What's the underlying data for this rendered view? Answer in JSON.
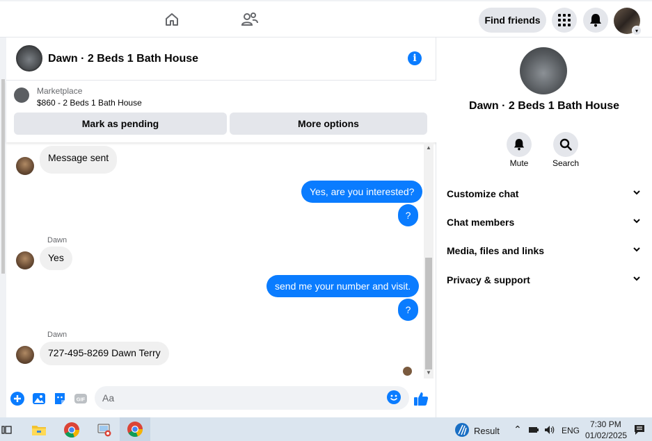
{
  "nav": {
    "find_friends": "Find friends"
  },
  "chat": {
    "title": "Dawn · 2 Beds 1 Bath House",
    "marketplace_label": "Marketplace",
    "listing": "$860 - 2 Beds 1 Bath House",
    "mark_pending": "Mark as pending",
    "more_options": "More options",
    "messages": [
      {
        "dir": "in",
        "text": "Message sent"
      },
      {
        "dir": "out",
        "text": "Yes, are you interested?"
      },
      {
        "dir": "out",
        "text": "?"
      },
      {
        "dir": "in",
        "sender": "Dawn",
        "text": "Yes"
      },
      {
        "dir": "out",
        "text": "send me your number and visit."
      },
      {
        "dir": "out",
        "text": "?"
      },
      {
        "dir": "in",
        "sender": "Dawn",
        "text": "727-495-8269 Dawn Terry"
      }
    ],
    "composer_placeholder": "Aa"
  },
  "details": {
    "title": "Dawn · 2 Beds 1 Bath House",
    "mute": "Mute",
    "search": "Search",
    "sections": [
      "Customize chat",
      "Chat members",
      "Media, files and links",
      "Privacy & support"
    ]
  },
  "taskbar": {
    "weather_label": "Result",
    "lang": "ENG",
    "time": "7:30 PM",
    "date": "01/02/2025"
  },
  "colors": {
    "accent": "#0a7cff",
    "bubble_in": "#f0f0f0",
    "button_gray": "#e4e6eb"
  }
}
